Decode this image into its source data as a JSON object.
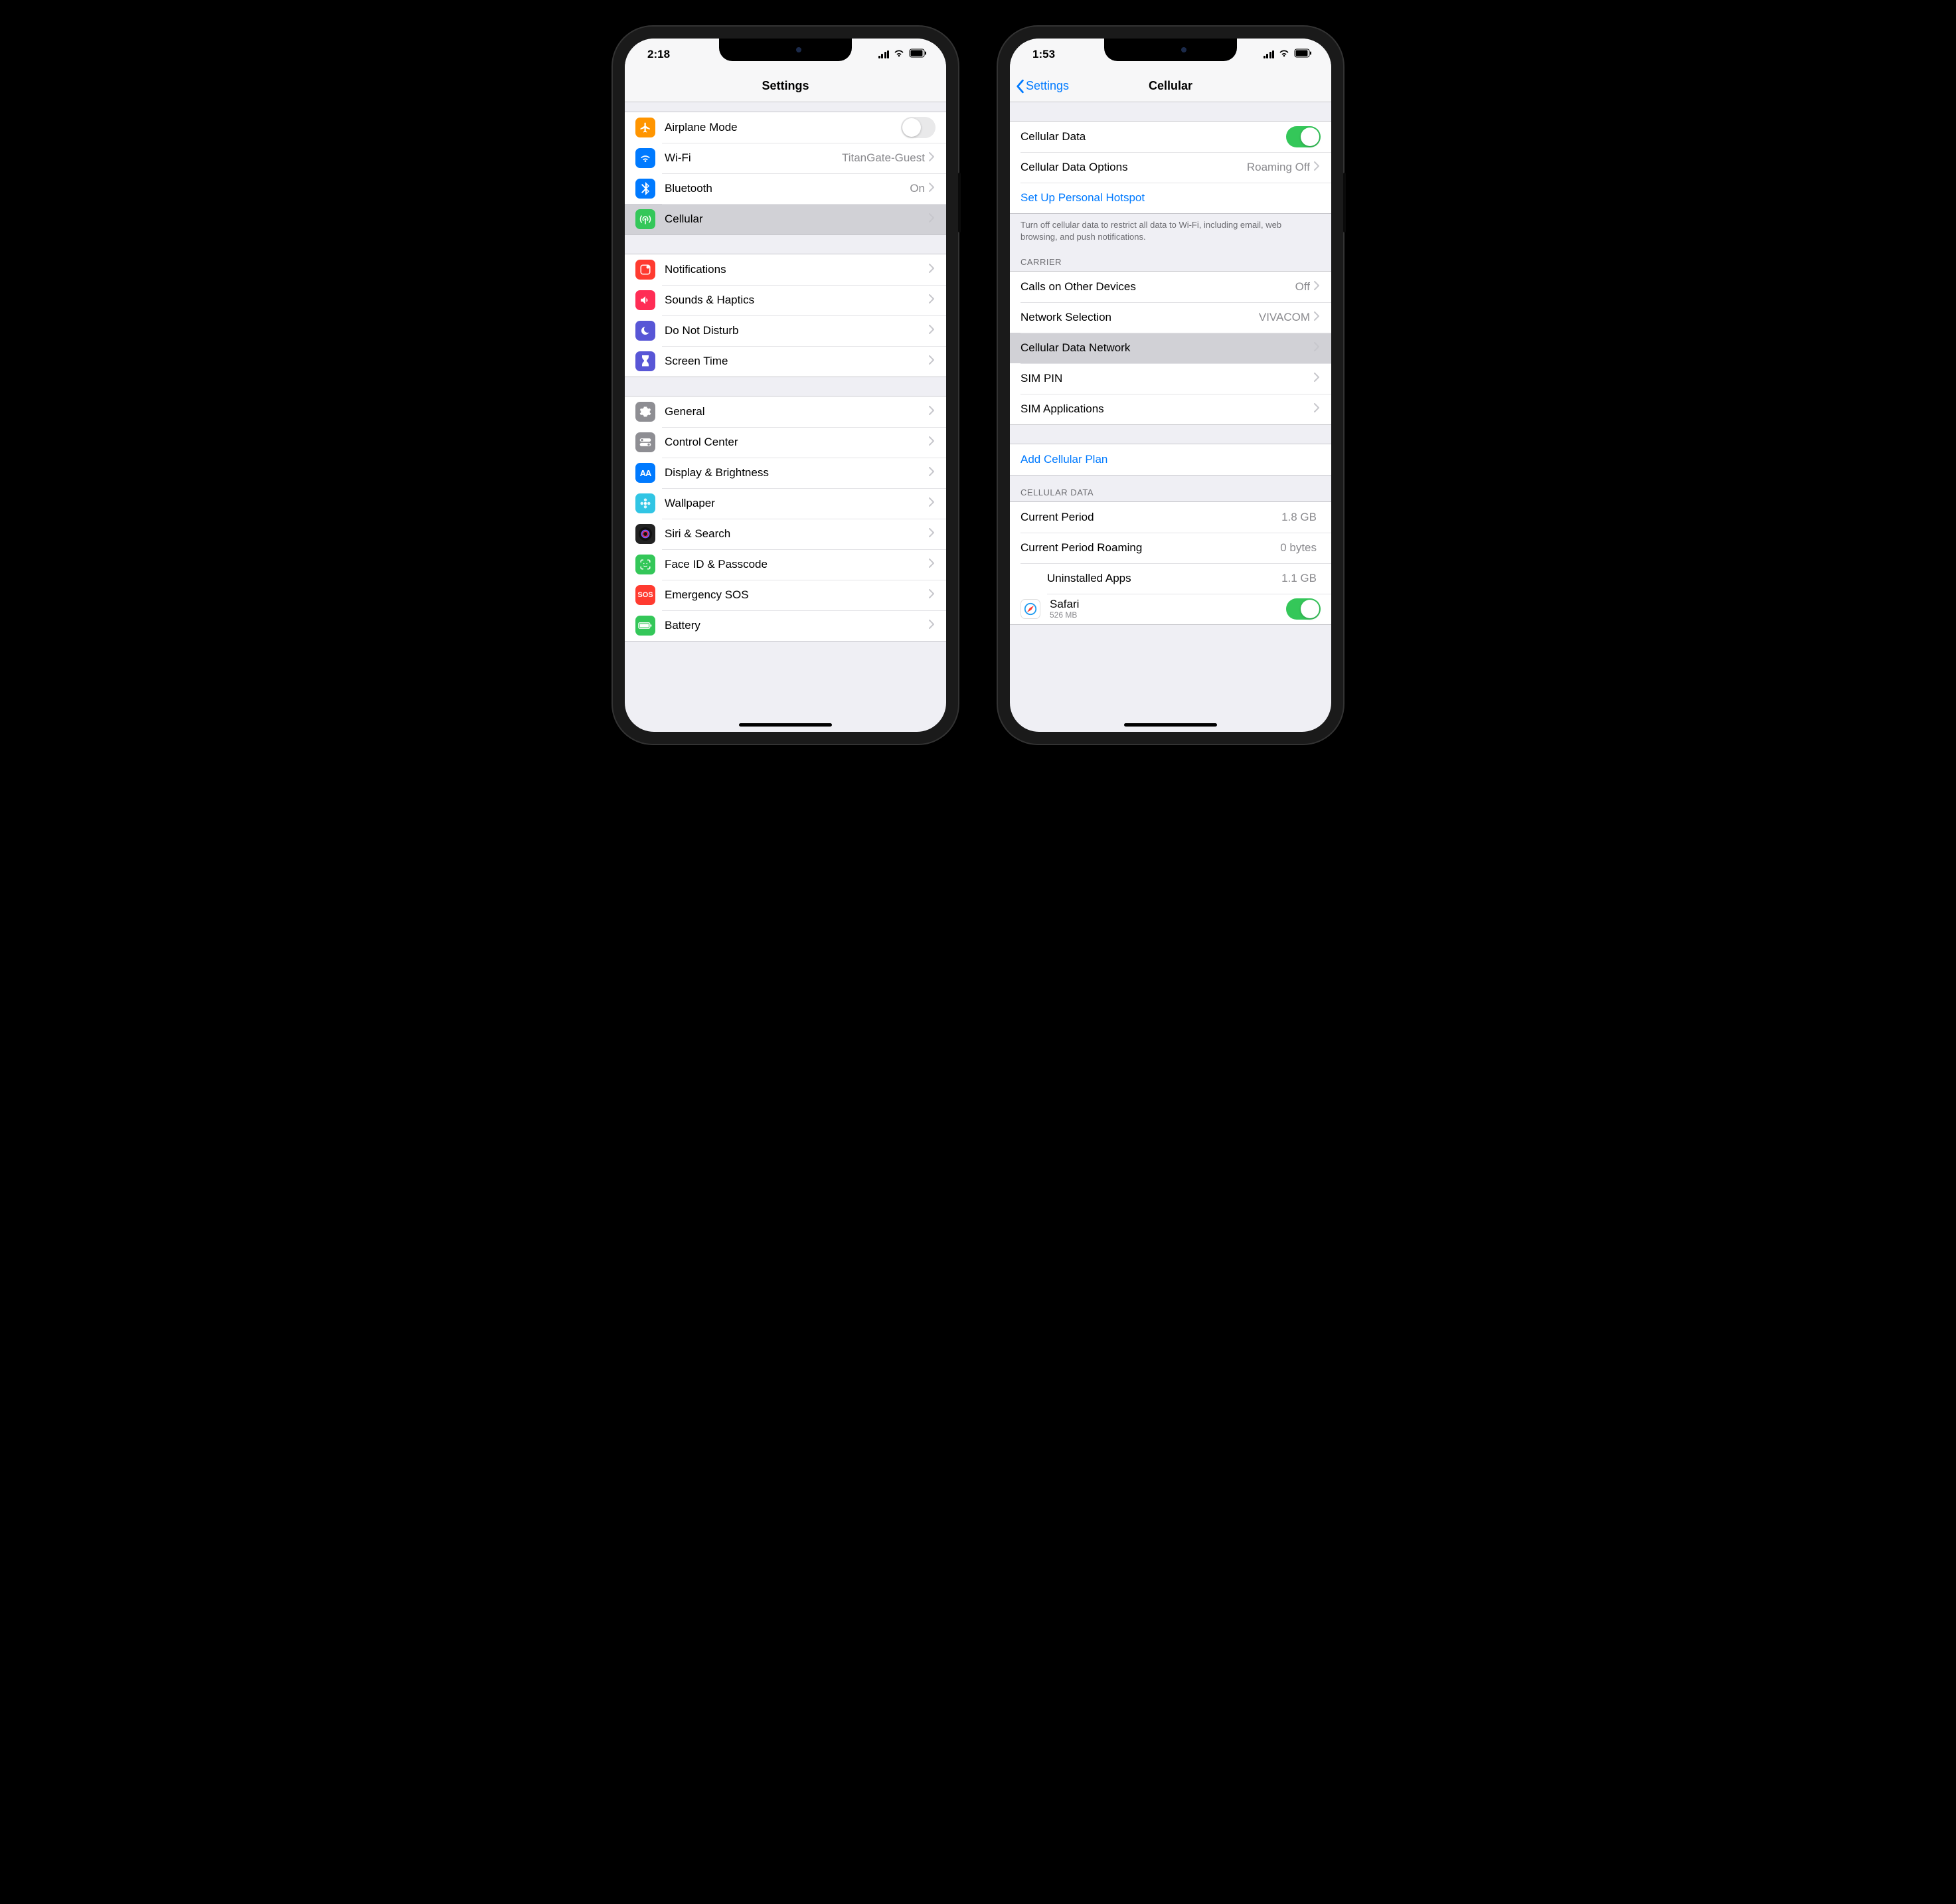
{
  "phone_left": {
    "time": "2:18",
    "title": "Settings",
    "group1": [
      {
        "icon": "airplane",
        "color": "#ff9500",
        "label": "Airplane Mode",
        "toggle": false
      },
      {
        "icon": "wifi",
        "color": "#007aff",
        "label": "Wi-Fi",
        "value": "TitanGate-Guest",
        "chevron": true
      },
      {
        "icon": "bluetooth",
        "color": "#007aff",
        "label": "Bluetooth",
        "value": "On",
        "chevron": true
      },
      {
        "icon": "antenna",
        "color": "#34c759",
        "label": "Cellular",
        "chevron": true,
        "selected": true
      }
    ],
    "group2": [
      {
        "icon": "bell",
        "color": "#ff3b30",
        "label": "Notifications",
        "chevron": true
      },
      {
        "icon": "speaker",
        "color": "#ff2d55",
        "label": "Sounds & Haptics",
        "chevron": true
      },
      {
        "icon": "moon",
        "color": "#5856d6",
        "label": "Do Not Disturb",
        "chevron": true
      },
      {
        "icon": "hourglass",
        "color": "#5856d6",
        "label": "Screen Time",
        "chevron": true
      }
    ],
    "group3": [
      {
        "icon": "gear",
        "color": "#8e8e93",
        "label": "General",
        "chevron": true
      },
      {
        "icon": "switches",
        "color": "#8e8e93",
        "label": "Control Center",
        "chevron": true
      },
      {
        "icon": "aa",
        "color": "#007aff",
        "label": "Display & Brightness",
        "chevron": true
      },
      {
        "icon": "flower",
        "color": "#31c5e4",
        "label": "Wallpaper",
        "chevron": true
      },
      {
        "icon": "siri",
        "color": "#222",
        "label": "Siri & Search",
        "chevron": true
      },
      {
        "icon": "faceid",
        "color": "#34c759",
        "label": "Face ID & Passcode",
        "chevron": true
      },
      {
        "icon": "sos",
        "color": "#ff3b30",
        "label": "Emergency SOS",
        "chevron": true
      },
      {
        "icon": "battery",
        "color": "#34c759",
        "label": "Battery",
        "chevron": true
      }
    ]
  },
  "phone_right": {
    "time": "1:53",
    "back": "Settings",
    "title": "Cellular",
    "group1": {
      "cellular_data": "Cellular Data",
      "cellular_data_on": true,
      "options_label": "Cellular Data Options",
      "options_value": "Roaming Off",
      "hotspot": "Set Up Personal Hotspot",
      "footer": "Turn off cellular data to restrict all data to Wi-Fi, including email, web browsing, and push notifications."
    },
    "carrier_header": "CARRIER",
    "carrier": [
      {
        "label": "Calls on Other Devices",
        "value": "Off",
        "chevron": true
      },
      {
        "label": "Network Selection",
        "value": "VIVACOM",
        "chevron": true
      },
      {
        "label": "Cellular Data Network",
        "chevron": true,
        "selected": true
      },
      {
        "label": "SIM PIN",
        "chevron": true
      },
      {
        "label": "SIM Applications",
        "chevron": true
      }
    ],
    "add_plan": "Add Cellular Plan",
    "data_header": "CELLULAR DATA",
    "data_rows": {
      "current_period_label": "Current Period",
      "current_period_value": "1.8 GB",
      "roaming_label": "Current Period Roaming",
      "roaming_value": "0 bytes",
      "uninstalled_label": "Uninstalled Apps",
      "uninstalled_value": "1.1 GB",
      "safari_label": "Safari",
      "safari_sub": "526 MB",
      "safari_on": true
    }
  }
}
